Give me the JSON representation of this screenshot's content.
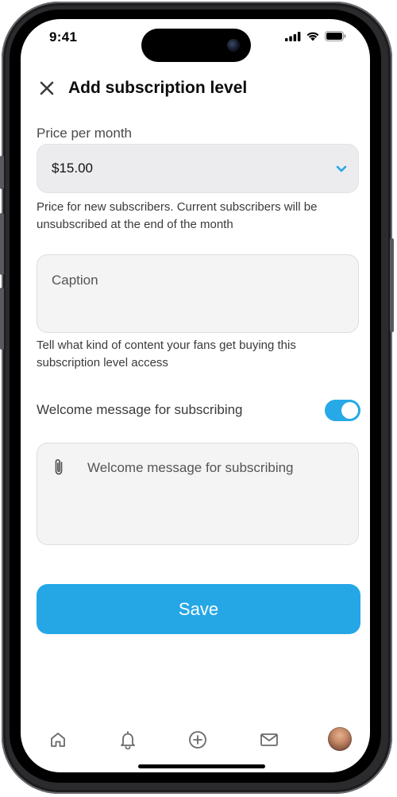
{
  "status_bar": {
    "time": "9:41"
  },
  "header": {
    "title": "Add subscription level",
    "close_icon": "close-icon"
  },
  "price": {
    "label": "Price per month",
    "value": "$15.00",
    "helper": "Price for new subscribers. Current subscribers will be unsubscribed at the end of the month"
  },
  "caption": {
    "placeholder": "Caption",
    "helper": "Tell what kind of content your fans get buying this subscription level access"
  },
  "welcome": {
    "toggle_label": "Welcome message for subscribing",
    "toggle_on": true,
    "placeholder": "Welcome message for subscribing"
  },
  "save_label": "Save",
  "tab_bar": {
    "items": [
      "home-icon",
      "bell-icon",
      "plus-circle-icon",
      "mail-icon",
      "avatar"
    ]
  },
  "colors": {
    "accent": "#25a7e6",
    "input_bg": "#ececee",
    "text_primary": "#0b0b0b"
  }
}
